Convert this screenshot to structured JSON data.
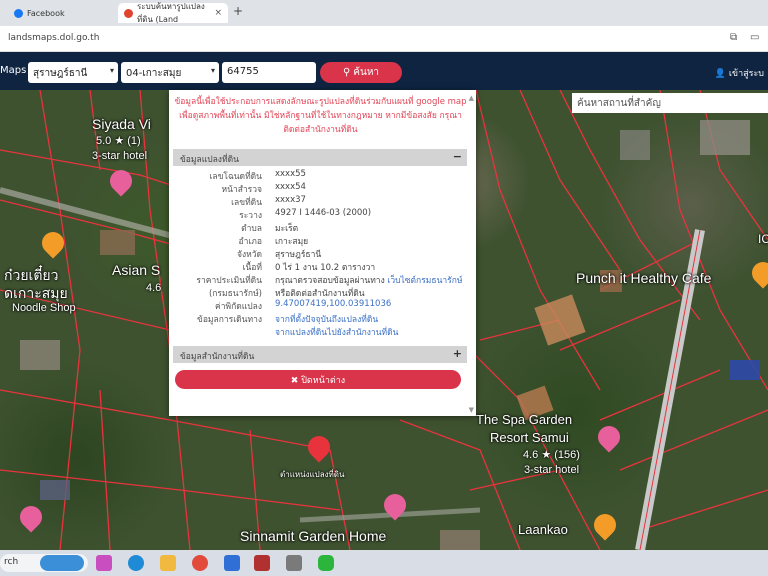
{
  "browser": {
    "tabs": [
      {
        "label": "Facebook",
        "favicon_color": "#1877f2"
      },
      {
        "label": "ระบบค้นหารูปแปลงที่ดิน (Land",
        "favicon_color": "#e0442f"
      }
    ],
    "new_tab_symbol": "+",
    "url": "landsmaps.dol.go.th"
  },
  "toolbar": {
    "brand": "Maps",
    "province": "สุราษฎร์ธานี",
    "district": "04-เกาะสมุย",
    "parcel_no": "64755",
    "search_label": "ค้นหา",
    "login_label": "เข้าสู่ระบ"
  },
  "map": {
    "search_placeholder": "ค้นหาสถานที่สำคัญ",
    "labels": [
      {
        "text": "Siyada Vi"
      },
      {
        "text": "5.0 ★ (1)"
      },
      {
        "text": "3-star hotel"
      },
      {
        "text": "Asian S"
      },
      {
        "text": "4.6"
      },
      {
        "text": "ก๋วยเตี๋ยว"
      },
      {
        "text": "ดเกาะสมุย"
      },
      {
        "text": "Noodle Shop"
      },
      {
        "text": "Punch it Healthy Cafe"
      },
      {
        "text": "The Spa Garden"
      },
      {
        "text": "Resort Samui"
      },
      {
        "text": "4.6 ★ (156)"
      },
      {
        "text": "3-star hotel"
      },
      {
        "text": "Sinnamit Garden Home"
      },
      {
        "text": "Laankao"
      },
      {
        "text": "ตำแหน่งแปลงที่ดิน"
      },
      {
        "text": "IC"
      }
    ]
  },
  "popup": {
    "notice": "ข้อมูลนี้เพื่อใช้ประกอบการแสดงลักษณะรูปแปลงที่ดินร่วมกับแผนที่ google map เพื่อดูสภาพพื้นที่เท่านั้น มิใช่หลักฐานที่ใช้ในทางกฎหมาย หากมีข้อสงสัย กรุณาติดต่อสำนักงานที่ดิน",
    "section1_title": "ข้อมูลแปลงที่ดิน",
    "section1_toggle": "−",
    "rows": [
      {
        "k": "เลขโฉนดที่ดิน",
        "v": "xxxx55"
      },
      {
        "k": "หน้าสำรวจ",
        "v": "xxxx54"
      },
      {
        "k": "เลขที่ดิน",
        "v": "xxxx37"
      },
      {
        "k": "ระวาง",
        "v": "4927 I 1446-03 (2000)"
      },
      {
        "k": "ตำบล",
        "v": "มะเร็ต"
      },
      {
        "k": "อำเภอ",
        "v": "เกาะสมุย"
      },
      {
        "k": "จังหวัด",
        "v": "สุราษฎร์ธานี"
      },
      {
        "k": "เนื้อที่",
        "v": "0 ไร่ 1 งาน 10.2 ตารางวา"
      },
      {
        "k": "ราคาประเมินที่ดิน",
        "v": "กรุณาตรวจสอบข้อมูลผ่านทาง ",
        "v_link": "เว็บไซต์กรมธนารักษ์"
      },
      {
        "k": "(กรมธนารักษ์)",
        "v": "หรือติดต่อสำนักงานที่ดิน"
      },
      {
        "k": "ค่าพิกัดแปลง",
        "v": "9.47007419,100.03911036",
        "link": true
      },
      {
        "k": "ข้อมูลการเดินทาง",
        "v": "จากที่ตั้งปัจจุบันถึงแปลงที่ดิน",
        "link": true
      },
      {
        "k": "",
        "v": "จากแปลงที่ดินไปยังสำนักงานที่ดิน",
        "link": true
      }
    ],
    "section2_title": "ข้อมูลสำนักงานที่ดิน",
    "section2_toggle": "+",
    "close_label": "✖ ปิดหน้าต่าง"
  },
  "taskbar": {
    "search_text": "rch"
  }
}
